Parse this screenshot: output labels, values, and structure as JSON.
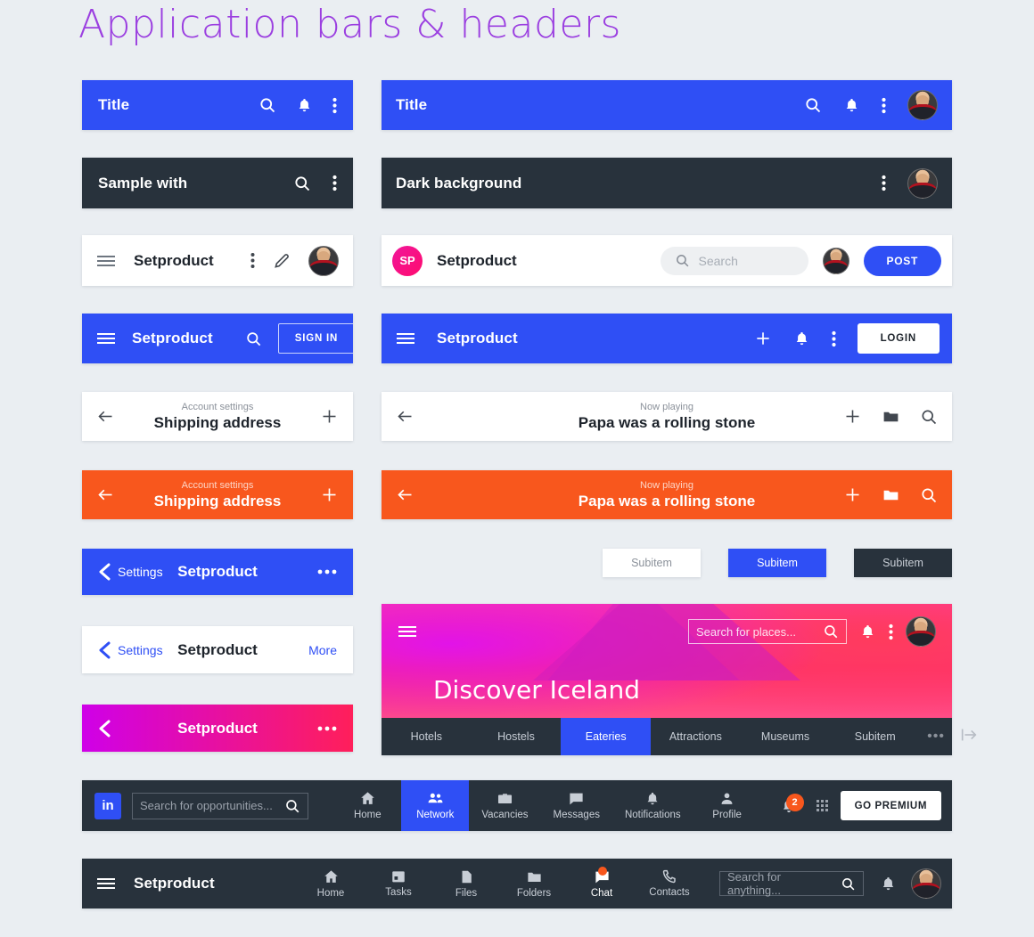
{
  "page": {
    "title": "Application bars & headers"
  },
  "bar1": {
    "title": "Title",
    "icons": [
      "search-icon",
      "bell-icon",
      "kebab-menu-icon"
    ]
  },
  "bar2": {
    "title": "Title",
    "icons": [
      "search-icon",
      "bell-icon",
      "kebab-menu-icon",
      "avatar"
    ]
  },
  "bar3": {
    "title": "Sample with",
    "icons": [
      "search-icon",
      "kebab-menu-icon"
    ]
  },
  "bar4": {
    "title": "Dark background",
    "icons": [
      "kebab-menu-icon",
      "avatar"
    ]
  },
  "bar5": {
    "title": "Setproduct",
    "icons": [
      "hamburger-icon",
      "kebab-menu-icon",
      "pencil-icon",
      "avatar"
    ]
  },
  "bar6": {
    "badge": "SP",
    "title": "Setproduct",
    "search_placeholder": "Search",
    "post_label": "POST"
  },
  "bar7": {
    "title": "Setproduct",
    "signin_label": "SIGN IN"
  },
  "bar8": {
    "title": "Setproduct",
    "login_label": "LOGIN"
  },
  "bar9": {
    "subtitle": "Account settings",
    "title": "Shipping address"
  },
  "bar10": {
    "subtitle": "Now playing",
    "title": "Papa was a rolling stone"
  },
  "bar11": {
    "subtitle": "Account settings",
    "title": "Shipping address"
  },
  "bar12": {
    "subtitle": "Now playing",
    "title": "Papa was a rolling stone"
  },
  "bar13": {
    "back_label": "Settings",
    "title": "Setproduct",
    "more_icon": "ellipsis-icon"
  },
  "bar14": {
    "back_label": "Settings",
    "title": "Setproduct",
    "action_label": "More"
  },
  "bar15": {
    "title": "Setproduct",
    "more_icon": "ellipsis-icon"
  },
  "chips": [
    {
      "label": "Subitem",
      "style": "white"
    },
    {
      "label": "Subitem",
      "style": "blue"
    },
    {
      "label": "Subitem",
      "style": "dark"
    }
  ],
  "hero": {
    "heading": "Discover Iceland",
    "search_placeholder": "Search for places...",
    "tabs": [
      {
        "label": "Hotels",
        "active": false
      },
      {
        "label": "Hostels",
        "active": false
      },
      {
        "label": "Eateries",
        "active": true
      },
      {
        "label": "Attractions",
        "active": false
      },
      {
        "label": "Museums",
        "active": false
      },
      {
        "label": "Subitem",
        "active": false
      }
    ],
    "overflow": "•••"
  },
  "linkedin": {
    "logo": "in",
    "search_placeholder": "Search for opportunities...",
    "items": [
      {
        "label": "Home",
        "icon": "home-icon",
        "active": false
      },
      {
        "label": "Network",
        "icon": "people-icon",
        "active": true
      },
      {
        "label": "Vacancies",
        "icon": "briefcase-icon",
        "active": false
      },
      {
        "label": "Messages",
        "icon": "message-icon",
        "active": false
      },
      {
        "label": "Notifications",
        "icon": "bell-icon",
        "active": false
      },
      {
        "label": "Profile",
        "icon": "account-icon",
        "active": false
      }
    ],
    "notification_count": "2",
    "premium_label": "GO PREMIUM"
  },
  "bottombar": {
    "title": "Setproduct",
    "items": [
      {
        "label": "Home",
        "icon": "home-icon",
        "active": false,
        "badge": false
      },
      {
        "label": "Tasks",
        "icon": "calendar-icon",
        "active": false,
        "badge": false
      },
      {
        "label": "Files",
        "icon": "file-icon",
        "active": false,
        "badge": false
      },
      {
        "label": "Folders",
        "icon": "folder-icon",
        "active": false,
        "badge": false
      },
      {
        "label": "Chat",
        "icon": "message-icon",
        "active": true,
        "badge": true
      },
      {
        "label": "Contacts",
        "icon": "phone-icon",
        "active": false,
        "badge": false
      }
    ],
    "search_placeholder": "Search for anything..."
  },
  "colors": {
    "blue": "#2f4ff5",
    "dark": "#28323c",
    "orange": "#f8571d",
    "pink": "#f0179b",
    "purple": "#9b3fe0",
    "page_bg": "#eaeef2"
  }
}
